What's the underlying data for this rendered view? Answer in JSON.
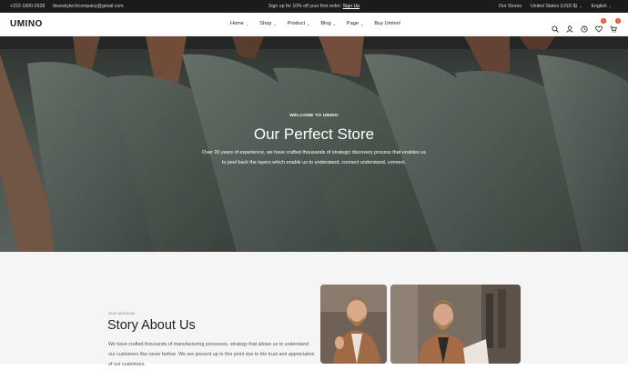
{
  "topbar": {
    "phone": "+222-1800-2628",
    "email": "blueskytechcompany@gmail.com",
    "promo_text": "Sign up for 10% off your first order:",
    "promo_link": "Sign Up",
    "our_stores": "Our Stores",
    "currency": "United States (USD $)",
    "language": "English"
  },
  "header": {
    "logo": "UMINO",
    "nav": [
      {
        "label": "Home",
        "dropdown": true
      },
      {
        "label": "Shop",
        "dropdown": true
      },
      {
        "label": "Product",
        "dropdown": true
      },
      {
        "label": "Blog",
        "dropdown": true
      },
      {
        "label": "Page",
        "dropdown": true
      },
      {
        "label": "Buy Umino!",
        "dropdown": false
      }
    ],
    "wishlist_count": "0",
    "cart_count": "0"
  },
  "hero": {
    "eyebrow": "WELCOME TO UMINO",
    "title": "Our Perfect Store",
    "description": "Over 20 years of experience, we have crafted thousands of strategic discovery process that enables us to peel back the layers which enable us to understand, connect understand, connect."
  },
  "story": {
    "eyebrow": "OUR MISSION",
    "title": "Story About Us",
    "text": "We have crafted thousands of manufacturing processes, strategy that allows us to understand our customers like never before. We are present up to this point due to the trust and appreciation of our customers."
  },
  "colors": {
    "topbar_bg": "#1b1b1b",
    "badge": "#e8492d",
    "hero_tint": "#55605a",
    "section_bg": "#f5f5f5"
  }
}
